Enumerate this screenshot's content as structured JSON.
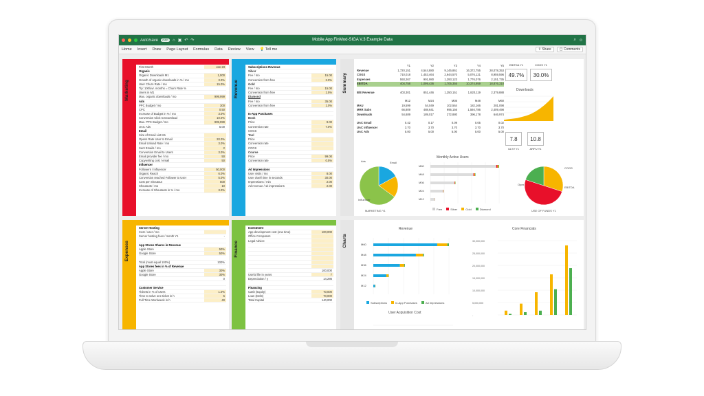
{
  "window": {
    "autosave": "AutoSave",
    "autosave_state": "OFF",
    "title": "Mobile App FinMod-SIGA V.3 Example Data"
  },
  "ribbon": {
    "tabs": [
      "Home",
      "Insert",
      "Draw",
      "Page Layout",
      "Formulas",
      "Data",
      "Review",
      "View",
      "Tell me"
    ],
    "share": "Share",
    "comments": "Comments"
  },
  "marketing": {
    "title": "Marketing",
    "color": "#e8102a",
    "rows": [
      {
        "l": "First Month",
        "v": "Jan 23",
        "t": "in"
      },
      {
        "l": "Organic",
        "t": "hd"
      },
      {
        "l": "Organic Downloads M1",
        "v": "1,000",
        "t": "in"
      },
      {
        "l": "Growth of organic downloads in % / mo",
        "v": "3.0%",
        "t": "in"
      },
      {
        "l": "User Churn Rate / mo",
        "v": "15.0%",
        "t": "in"
      },
      {
        "l": "Tip: 100/avr. months = Churn Rate %"
      },
      {
        "l": "Users in M1"
      },
      {
        "l": "Max. organic downloads / mo",
        "v": "999,999",
        "t": "in"
      },
      {
        "l": "Ads",
        "t": "hd"
      },
      {
        "l": "PPC Budget / mo",
        "v": "300",
        "t": "in"
      },
      {
        "l": "CPC",
        "v": "0.50",
        "t": "in"
      },
      {
        "l": "Increase of Budget in % / mo",
        "v": "3.0%",
        "t": "in"
      },
      {
        "l": "Conversion Click to Download",
        "v": "10.0%",
        "t": "in"
      },
      {
        "l": "Max. PPC Budget / mo",
        "v": "999,999",
        "t": "in"
      },
      {
        "l": "UAC Ads",
        "v": "5.00"
      },
      {
        "l": "Email",
        "t": "hd"
      },
      {
        "l": "Size of Email List M1",
        "v": "",
        "t": "in"
      },
      {
        "l": "Opens Rate User to Email",
        "v": "20.0%",
        "t": "in"
      },
      {
        "l": "Email Unload Rate / mo",
        "v": "3.0%",
        "t": "in"
      },
      {
        "l": "Sent Emails / mo",
        "v": "2",
        "t": "in"
      },
      {
        "l": "Conversion Email to Users",
        "v": "3.0%",
        "t": "in"
      },
      {
        "l": "Email provider fee / mo",
        "v": "50",
        "t": "in"
      },
      {
        "l": "Copywriting cost / email",
        "v": "50",
        "t": "in"
      },
      {
        "l": "Influencer",
        "t": "hd"
      },
      {
        "l": "Followers / Influencer",
        "v": "50,000",
        "t": "in"
      },
      {
        "l": "Organic Reach",
        "v": "6.0%",
        "t": "in"
      },
      {
        "l": "Conversion reached Follower to User",
        "v": "5.0%",
        "t": "in"
      },
      {
        "l": "Cost per Shoutout",
        "v": "500",
        "t": "in"
      },
      {
        "l": "Shoutouts / mo",
        "v": "10",
        "t": "in"
      },
      {
        "l": "Increase of Shoutouts in % / mo",
        "v": "3.0%",
        "t": "in"
      }
    ]
  },
  "revenue": {
    "title": "Revenue",
    "color": "#1aa7e0",
    "rows": [
      {
        "l": "Subscriptions Revenue",
        "t": "hd"
      },
      {
        "l": "Silver",
        "t": "u"
      },
      {
        "l": "Fee / mo",
        "v": "15.00",
        "t": "in"
      },
      {
        "l": "Conversion from free",
        "v": "2.0%",
        "t": "in"
      },
      {
        "l": "Gold",
        "t": "u"
      },
      {
        "l": "Fee / mo",
        "v": "15.00",
        "t": "in"
      },
      {
        "l": "Conversion from free",
        "v": "1.5%",
        "t": "in"
      },
      {
        "l": "Diamond",
        "t": "u"
      },
      {
        "l": "Fee / mo",
        "v": "35.00",
        "t": "in"
      },
      {
        "l": "Conversion from free",
        "v": "1.0%",
        "t": "in"
      },
      {
        "l": ""
      },
      {
        "l": "In-App Purchases",
        "t": "hd"
      },
      {
        "l": "Book",
        "t": "u"
      },
      {
        "l": "Price",
        "v": "9.00",
        "t": "in"
      },
      {
        "l": "Conversion rate",
        "v": "7.0%",
        "t": "in"
      },
      {
        "l": "COGS",
        "v": "",
        "t": "in"
      },
      {
        "l": "Tool",
        "t": "u"
      },
      {
        "l": "Price",
        "v": "",
        "t": "in"
      },
      {
        "l": "Conversion rate",
        "v": "",
        "t": "in"
      },
      {
        "l": "COGS",
        "v": "",
        "t": "in"
      },
      {
        "l": "Course",
        "t": "u"
      },
      {
        "l": "Price",
        "v": "99.00",
        "t": "in"
      },
      {
        "l": "Conversion rate",
        "v": "0.5%",
        "t": "in"
      },
      {
        "l": ""
      },
      {
        "l": "Ad Impressions",
        "t": "hd"
      },
      {
        "l": "User visits / mo",
        "v": "8.00",
        "t": "in"
      },
      {
        "l": "User dwell time in seconds",
        "v": "30.00",
        "t": "in"
      },
      {
        "l": "Impressions / min",
        "v": "2.00",
        "t": "in"
      },
      {
        "l": "Ad revenue / 1k impressions",
        "v": "2.00",
        "t": "in"
      }
    ]
  },
  "expenses": {
    "title": "Expenses",
    "color": "#f7b500",
    "rows": [
      {
        "l": "Server Hosting",
        "t": "hd"
      },
      {
        "l": "Cost / user / mo",
        "v": "",
        "t": "in"
      },
      {
        "l": "Server hosting fees / month Y1",
        "v": "-"
      },
      {
        "l": ""
      },
      {
        "l": "App Stores Shares in Revenue",
        "t": "hd"
      },
      {
        "l": "Apple Store",
        "v": "50%",
        "t": "in"
      },
      {
        "l": "Google Store",
        "v": "50%",
        "t": "in"
      },
      {
        "l": ""
      },
      {
        "l": "Total (must equal 100%)",
        "v": "100%"
      },
      {
        "l": "App Stores fees in % of Revenue",
        "t": "hd"
      },
      {
        "l": "Apple Store",
        "v": "30%",
        "t": "in"
      },
      {
        "l": "Google Store",
        "v": "30%",
        "t": "in"
      },
      {
        "l": "",
        "v": "0"
      },
      {
        "l": ""
      },
      {
        "l": "Customer Service",
        "t": "hd"
      },
      {
        "l": "Tickets in % of users",
        "v": "1.0%",
        "t": "in"
      },
      {
        "l": "Time to solve one ticket in h",
        "v": "5",
        "t": "in"
      },
      {
        "l": "Full Time Workweek in h",
        "v": "40",
        "t": "in"
      }
    ]
  },
  "finance": {
    "title": "Finance",
    "color": "#7dc242",
    "rows": [
      {
        "l": "Investment",
        "t": "hd"
      },
      {
        "l": "App development cost (one time)",
        "v": "100,000",
        "t": "in"
      },
      {
        "l": "Office Computers",
        "v": "",
        "t": "in"
      },
      {
        "l": "Legal Advice",
        "v": "",
        "t": "in"
      },
      {
        "l": "",
        "v": "",
        "t": "in"
      },
      {
        "l": "",
        "v": "",
        "t": "in"
      },
      {
        "l": "",
        "v": "",
        "t": "in"
      },
      {
        "l": "",
        "v": "",
        "t": "in"
      },
      {
        "l": "",
        "v": "",
        "t": "in"
      },
      {
        "l": "",
        "v": "",
        "t": "in"
      },
      {
        "l": "",
        "v": "100,000"
      },
      {
        "l": "Useful life in years",
        "v": "7",
        "t": "in"
      },
      {
        "l": "Depreciation / y",
        "v": "14,286"
      },
      {
        "l": ""
      },
      {
        "l": "Financing",
        "t": "hd"
      },
      {
        "l": "Cash (Equity)",
        "v": "70,000",
        "t": "in"
      },
      {
        "l": "Loan (Debt)",
        "v": "70,000",
        "t": "in"
      },
      {
        "l": "Total Capital",
        "v": "140,000"
      }
    ]
  },
  "summary": {
    "title": "Summary",
    "header": [
      "",
      "Y1",
      "Y2",
      "Y3",
      "Y4",
      "Y5"
    ],
    "rows": [
      [
        "Revenue",
        "1,720,151",
        "4,544,880",
        "9,145,861",
        "16,372,755",
        "28,078,353"
      ],
      [
        "COGS",
        "710,018",
        "1,453,464",
        "2,944,570",
        "5,076,121",
        "8,959,596"
      ],
      [
        "Expenses",
        "593,267",
        "991,980",
        "1,293,123",
        "1,776,076",
        "2,151,735"
      ],
      [
        "EBITDA",
        "404,758",
        "1,099,436",
        "1,705,355",
        "10,374,959",
        "18,876,310"
      ]
    ],
    "breakeven": [
      "B/E Revenue",
      "403,301",
      "851,446",
      "1,250,151",
      "1,820,119",
      "2,379,888"
    ],
    "header2": [
      "",
      "M12",
      "M24",
      "M36",
      "M48",
      "M60"
    ],
    "rows2": [
      [
        "MAU",
        "19,599",
        "54,049",
        "102,564",
        "182,166",
        "281,098"
      ],
      [
        "MRR Subs",
        "66,809",
        "488,641",
        "995,156",
        "1,594,786",
        "2,409,498"
      ],
      [
        "Downloads",
        "54,689",
        "189,017",
        "272,880",
        "396,178",
        "646,974"
      ]
    ],
    "rows3": [
      [
        "UAC Email",
        "0.42",
        "0.17",
        "0.09",
        "0.05",
        "0.02"
      ],
      [
        "UAC Influencer",
        "3.70",
        "3.70",
        "3.70",
        "3.70",
        "3.70"
      ],
      [
        "UAC Ads",
        "5.00",
        "5.00",
        "5.00",
        "5.00",
        "5.00"
      ]
    ],
    "kpis": [
      {
        "label": "EBITDA Y1",
        "value": "49.7%"
      },
      {
        "label": "COGS Y1",
        "value": "30.0%"
      },
      {
        "label": "ULTV Y1",
        "value": "7.8"
      },
      {
        "label": "ARPU Y1",
        "value": "10.8"
      }
    ],
    "downloads_title": "Downloads",
    "mau_title": "Monthly Active Users",
    "donut_left_labels": [
      "Ads",
      "Email",
      "Influencer",
      "MARKETING Y1"
    ],
    "donut_right_labels": [
      "COGS",
      "EBITDA",
      "Opex",
      "USE OF FUNDS Y1"
    ]
  },
  "charts": {
    "title": "Charts",
    "revenue_title": "Revenue",
    "core_title": "Core Financials",
    "uac_title": "User Acquisition Cost",
    "revenue_legend": [
      {
        "name": "Subscriptions",
        "color": "#1aa7e0"
      },
      {
        "name": "In-App Purchases",
        "color": "#f7b500"
      },
      {
        "name": "Ad Impressions",
        "color": "#4caf50"
      }
    ],
    "mau_legend": [
      {
        "name": "Free",
        "color": "#cfcfcf"
      },
      {
        "name": "Silver",
        "color": "#e8102a"
      },
      {
        "name": "Gold",
        "color": "#f7b500"
      },
      {
        "name": "Diamond",
        "color": "#4caf50"
      }
    ]
  },
  "chart_data": [
    {
      "type": "bar",
      "title": "Monthly Active Users",
      "categories": [
        "M60",
        "M48",
        "M36",
        "M24",
        "M12"
      ],
      "series": [
        {
          "name": "Free",
          "values": [
            260000,
            170000,
            95000,
            50000,
            18000
          ]
        },
        {
          "name": "Silver",
          "values": [
            5000,
            3500,
            2000,
            1200,
            400
          ]
        },
        {
          "name": "Gold",
          "values": [
            3800,
            2600,
            1500,
            900,
            300
          ]
        },
        {
          "name": "Diamond",
          "values": [
            2500,
            1700,
            1000,
            600,
            200
          ]
        }
      ]
    },
    {
      "type": "bar",
      "title": "Revenue",
      "categories": [
        "M60",
        "M48",
        "M36",
        "M24",
        "M12"
      ],
      "series": [
        {
          "name": "Subscriptions",
          "values": [
            2400000,
            1600000,
            1000000,
            490000,
            67000
          ]
        },
        {
          "name": "In-App Purchases",
          "values": [
            380000,
            260000,
            160000,
            80000,
            12000
          ]
        },
        {
          "name": "Ad Impressions",
          "values": [
            60000,
            40000,
            25000,
            12000,
            2000
          ]
        }
      ]
    },
    {
      "type": "bar",
      "title": "Core Financials",
      "categories": [
        "Y1",
        "Y2",
        "Y3",
        "Y4",
        "Y5"
      ],
      "series": [
        {
          "name": "Revenue",
          "values": [
            1720151,
            4544880,
            9145861,
            16372755,
            28078353
          ]
        },
        {
          "name": "EBITDA",
          "values": [
            404758,
            1099436,
            1705355,
            10374959,
            18876310
          ]
        }
      ],
      "ylim": [
        0,
        30000000
      ],
      "ytick_labels": [
        "30,000,000",
        "25,000,000",
        "20,000,000",
        "15,000,000",
        "10,000,000",
        "5,000,000",
        "-"
      ]
    },
    {
      "type": "area",
      "title": "Downloads",
      "values": [
        2,
        3,
        4,
        5,
        7,
        9,
        12,
        16,
        21,
        27,
        34,
        42
      ]
    },
    {
      "type": "pie",
      "title": "MARKETING Y1",
      "labels": [
        "Ads",
        "Email",
        "Influencer"
      ],
      "values": [
        17,
        18,
        65
      ]
    },
    {
      "type": "pie",
      "title": "USE OF FUNDS Y1",
      "labels": [
        "COGS",
        "EBITDA",
        "Opex"
      ],
      "values": [
        30,
        50,
        20
      ]
    }
  ]
}
